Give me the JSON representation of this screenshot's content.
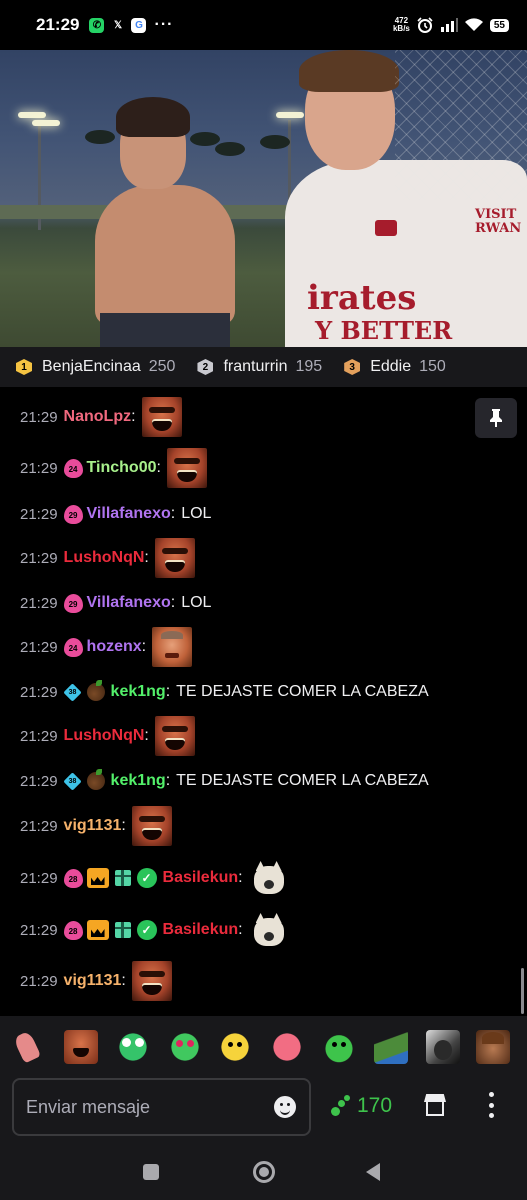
{
  "status_bar": {
    "time": "21:29",
    "apps": [
      {
        "icon": "whatsapp-icon",
        "glyph": "✆",
        "color": "#25d366"
      },
      {
        "icon": "x-icon",
        "glyph": "𝕏",
        "color": "#ffffff"
      },
      {
        "icon": "google-icon",
        "glyph": "G",
        "color": "#ffffff"
      }
    ],
    "more": "···",
    "speed_value": "472",
    "speed_unit": "kB/s",
    "battery": "55"
  },
  "leaderboard": [
    {
      "rank": "1",
      "name": "BenjaEncinaa",
      "score": "250",
      "color": "#f5c342"
    },
    {
      "rank": "2",
      "name": "franturrin",
      "score": "195",
      "color": "#c9c9cf"
    },
    {
      "rank": "3",
      "name": "Eddie",
      "score": "150",
      "color": "#e3a05c"
    }
  ],
  "chat": {
    "messages": [
      {
        "time": "21:29",
        "user": "NanoLpz",
        "color": "#f0697f",
        "badges": [],
        "text": "",
        "emote": "laugh-emote"
      },
      {
        "time": "21:29",
        "user": "Tincho00",
        "color": "#a8f08c",
        "badges": [
          {
            "type": "sub",
            "value": "24"
          }
        ],
        "text": "",
        "emote": "laugh-emote"
      },
      {
        "time": "21:29",
        "user": "Villafanexo",
        "color": "#b074f0",
        "badges": [
          {
            "type": "sub",
            "value": "29"
          }
        ],
        "text": "LOL",
        "emote": ""
      },
      {
        "time": "21:29",
        "user": "LushoNqN",
        "color": "#eb2b3c",
        "badges": [],
        "text": "",
        "emote": "laugh-emote"
      },
      {
        "time": "21:29",
        "user": "Villafanexo",
        "color": "#b074f0",
        "badges": [
          {
            "type": "sub",
            "value": "29"
          }
        ],
        "text": "LOL",
        "emote": ""
      },
      {
        "time": "21:29",
        "user": "hozenx",
        "color": "#b074f0",
        "badges": [
          {
            "type": "sub",
            "value": "24"
          }
        ],
        "text": "",
        "emote": "sad-emote"
      },
      {
        "time": "21:29",
        "user": "kek1ng",
        "color": "#53f06a",
        "badges": [
          {
            "type": "diamond",
            "value": "38"
          },
          {
            "type": "coconut",
            "value": ""
          }
        ],
        "text": "TE DEJASTE COMER LA CABEZA",
        "emote": ""
      },
      {
        "time": "21:29",
        "user": "LushoNqN",
        "color": "#eb2b3c",
        "badges": [],
        "text": "",
        "emote": "laugh-emote"
      },
      {
        "time": "21:29",
        "user": "kek1ng",
        "color": "#53f06a",
        "badges": [
          {
            "type": "diamond",
            "value": "38"
          },
          {
            "type": "coconut",
            "value": ""
          }
        ],
        "text": "TE DEJASTE COMER LA CABEZA",
        "emote": ""
      },
      {
        "time": "21:29",
        "user": "vig1131",
        "color": "#f6b26b",
        "badges": [],
        "text": "",
        "emote": "laugh-emote"
      },
      {
        "time": "21:29",
        "user": "Basilekun",
        "color": "#eb2b3c",
        "badges": [
          {
            "type": "sub",
            "value": "28"
          },
          {
            "type": "crown",
            "value": ""
          },
          {
            "type": "gift",
            "value": ""
          },
          {
            "type": "verified",
            "value": ""
          }
        ],
        "text": "",
        "emote": "cat-emote"
      },
      {
        "time": "21:29",
        "user": "Basilekun",
        "color": "#eb2b3c",
        "badges": [
          {
            "type": "sub",
            "value": "28"
          },
          {
            "type": "crown",
            "value": ""
          },
          {
            "type": "gift",
            "value": ""
          },
          {
            "type": "verified",
            "value": ""
          }
        ],
        "text": "",
        "emote": "cat-emote"
      },
      {
        "time": "21:29",
        "user": "vig1131",
        "color": "#f6b26b",
        "badges": [],
        "text": "",
        "emote": "laugh-emote"
      }
    ]
  },
  "emote_bar": [
    "praying-hands-emote",
    "laugh-emote",
    "frog-eyes-emote",
    "frog-heart-emote",
    "banana-emote",
    "pink-blob-emote",
    "green-slime-emote",
    "pepe-emote",
    "bw-face-emote",
    "man-face-emote"
  ],
  "input": {
    "placeholder": "Enviar mensaje",
    "value": ""
  },
  "points": "170",
  "video": {
    "shirt_line1": "irates",
    "shirt_line2": "Y BETTER",
    "shirt_sponsor": "VISIT RWAN"
  }
}
